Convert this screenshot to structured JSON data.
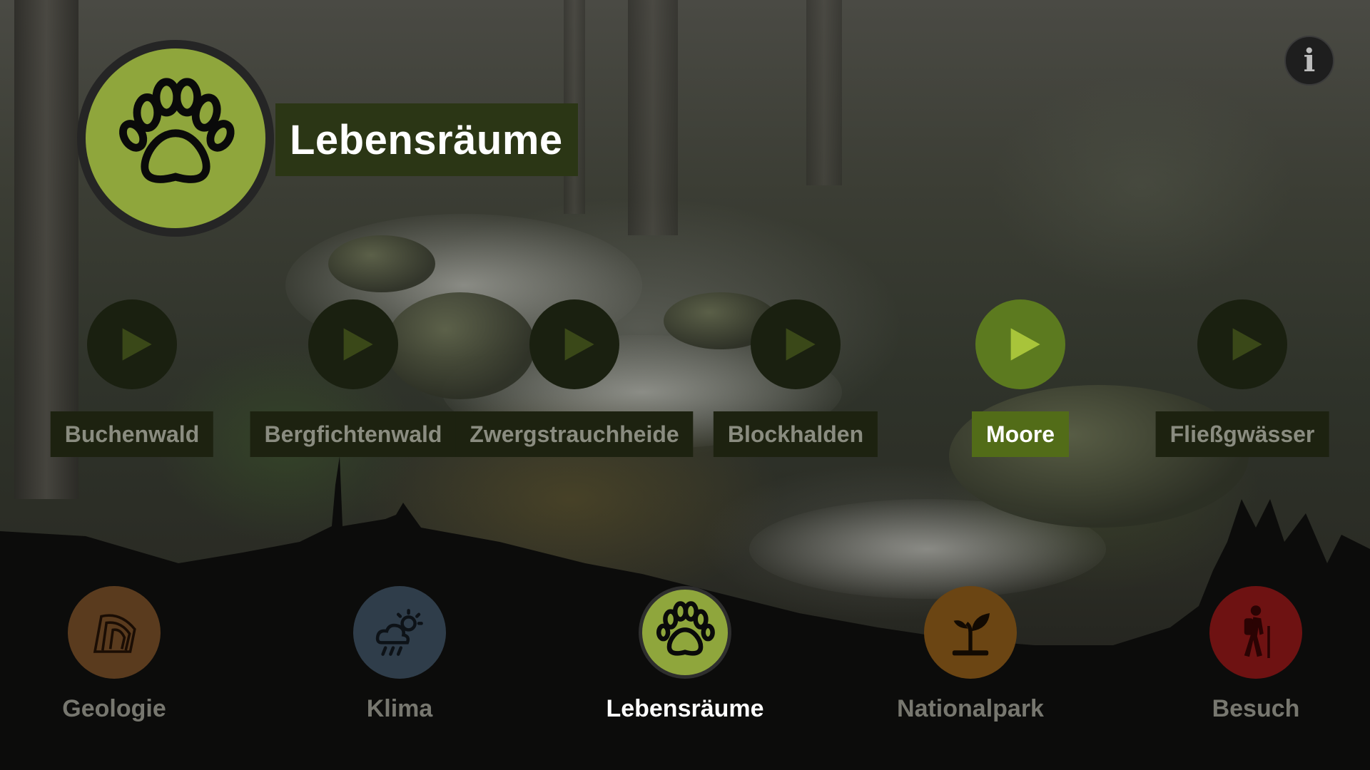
{
  "header": {
    "title": "Lebensräume",
    "icon": "paw-icon",
    "accent": "#8fa63c",
    "title_bg": "#2b3615"
  },
  "info_button": {
    "label": "i",
    "icon": "info-icon"
  },
  "habitats": [
    {
      "label": "Buchenwald",
      "active": false
    },
    {
      "label": "Bergfichtenwald",
      "active": false
    },
    {
      "label": "Zwergstrauchheide",
      "active": false
    },
    {
      "label": "Blockhalden",
      "active": false
    },
    {
      "label": "Moore",
      "active": true
    },
    {
      "label": "Fließgwässer",
      "active": false
    }
  ],
  "nav": [
    {
      "label": "Geologie",
      "icon": "rock-layers-icon",
      "color": "#5a3b1e",
      "active": false
    },
    {
      "label": "Klima",
      "icon": "weather-icon",
      "color": "#2f3d4a",
      "active": false
    },
    {
      "label": "Lebensräume",
      "icon": "paw-icon",
      "color": "#8fa63c",
      "active": true
    },
    {
      "label": "Nationalpark",
      "icon": "sprout-icon",
      "color": "#6b4513",
      "active": false
    },
    {
      "label": "Besuch",
      "icon": "hiker-icon",
      "color": "#6e1212",
      "active": false
    }
  ],
  "colors": {
    "habitat_active": "#526c18",
    "habitat_inactive": "#1d2210",
    "nav_label_inactive": "#77776f",
    "nav_label_active": "#ffffff"
  }
}
